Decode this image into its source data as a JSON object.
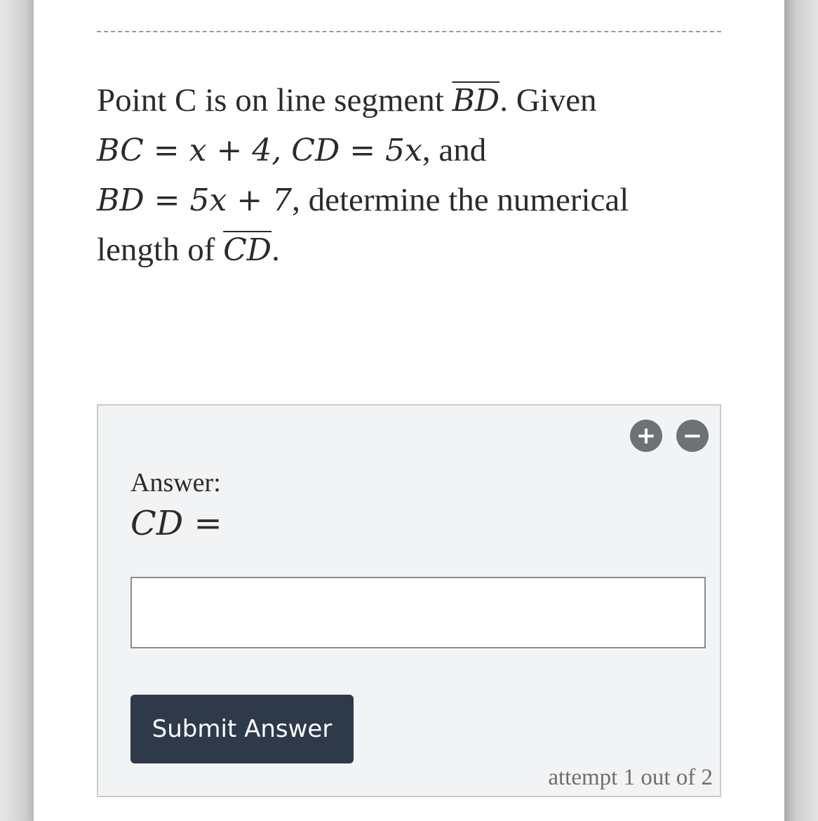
{
  "question": {
    "line1_text": "Point C is on line segment ",
    "seg_bd": "BD",
    "line1_tail": ". Given",
    "eq_bc": "BC = x + 4, CD = 5x",
    "line2_tail": ", and",
    "eq_bd": "BD = 5x + 7",
    "line3_tail": ", determine the numerical",
    "line4_text": "length of ",
    "seg_cd": "CD",
    "period": "."
  },
  "answer_panel": {
    "plus_icon": "+",
    "minus_icon": "−",
    "label": "Answer:",
    "math_label": "CD =",
    "input_value": "",
    "input_placeholder": "",
    "submit_label": "Submit Answer",
    "attempt_text": "attempt 1 out of 2"
  },
  "colors": {
    "submit_bg": "#2e3a4a",
    "panel_bg": "#f2f3f4",
    "icon_bg": "#6f7275"
  }
}
